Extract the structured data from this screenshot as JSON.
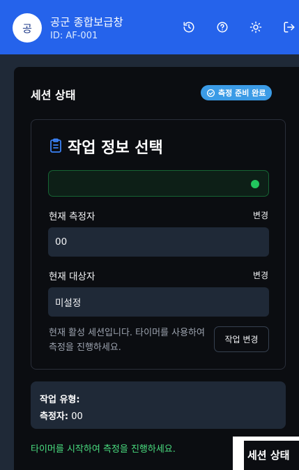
{
  "header": {
    "avatar_text": "공",
    "title": "공군 종합보급창",
    "user_id": "ID: AF-001",
    "icons": [
      "history-icon",
      "help-icon",
      "theme-toggle-icon",
      "logout-icon"
    ],
    "background_color": "#2563eb"
  },
  "session": {
    "title": "세션 상태",
    "badge_label": "측정 준비 완료",
    "badge_color": "#3b9be6"
  },
  "task_card": {
    "title": "작업 정보 선택",
    "status_indicator_color": "#22c55e",
    "measurer_label": "현재 측정자",
    "measurer_change": "변경",
    "measurer_value": "00",
    "target_label": "현재 대상자",
    "target_change": "변경",
    "target_value": "미설정",
    "help_text": "현재 활성 세션입니다. 타이머를 사용하여 측정을 진행하세요.",
    "change_button": "작업 변경"
  },
  "info": {
    "task_type_label": "작업 유형:",
    "task_type_value": "",
    "measurer_label": "측정자:",
    "measurer_value": "00"
  },
  "hint_text": "타이머를 시작하여 측정을 진행하세요.",
  "hint_color": "#4ade80",
  "overlap_panel": {
    "title": "세션 상태"
  }
}
